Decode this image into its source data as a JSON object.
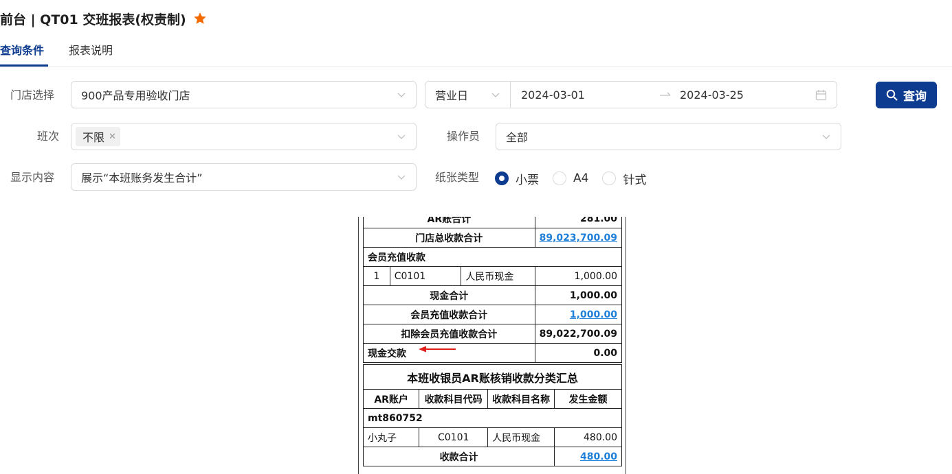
{
  "header": {
    "title": "前台 | QT01 交班报表(权责制)",
    "star_icon": "star-icon",
    "star_color": "#f56a00"
  },
  "tabs": [
    {
      "label": "查询条件",
      "active": true
    },
    {
      "label": "报表说明",
      "active": false
    }
  ],
  "filters": {
    "store": {
      "label": "门店选择",
      "value": "900产品专用验收门店"
    },
    "date_type": {
      "value": "营业日"
    },
    "date_range": {
      "start": "2024-03-01",
      "end": "2024-03-25"
    },
    "shift": {
      "label": "班次",
      "tag": "不限"
    },
    "operator": {
      "label": "操作员",
      "value": "全部"
    },
    "display": {
      "label": "显示内容",
      "value": "展示“本班账务发生合计”"
    },
    "paper": {
      "label": "纸张类型",
      "options": [
        {
          "label": "小票",
          "checked": true
        },
        {
          "label": "A4",
          "checked": false
        },
        {
          "label": "针式",
          "checked": false
        }
      ]
    }
  },
  "query_button": {
    "label": "查询"
  },
  "accent_color": "#0c3b8f",
  "receipt": {
    "ar_total_label": "AR账合计",
    "ar_total_value": "281.00",
    "store_total_label": "门店总收款合计",
    "store_total_value": "89,023,700.09",
    "member_section": "会员充值收款",
    "member_row": {
      "idx": "1",
      "code": "C0101",
      "name": "人民币现金",
      "amount": "1,000.00"
    },
    "cash_total_label": "现金合计",
    "cash_total_value": "1,000.00",
    "member_total_label": "会员充值收款合计",
    "member_total_value": "1,000.00",
    "excl_member_label": "扣除会员充值收款合计",
    "excl_member_value": "89,022,700.09",
    "cash_handover_label": "现金交款",
    "cash_handover_value": "0.00",
    "ar_summary_title": "本班收银员AR账核销收款分类汇总",
    "ar_headers": [
      "AR账户",
      "收款科目代码",
      "收款科目名称",
      "发生金额"
    ],
    "ar_account": "mt860752",
    "ar_row": {
      "name": "小丸子",
      "code": "C0101",
      "subject": "人民币现金",
      "amount": "480.00"
    },
    "ar_collect_label": "收款合计",
    "ar_collect_value": "480.00"
  }
}
